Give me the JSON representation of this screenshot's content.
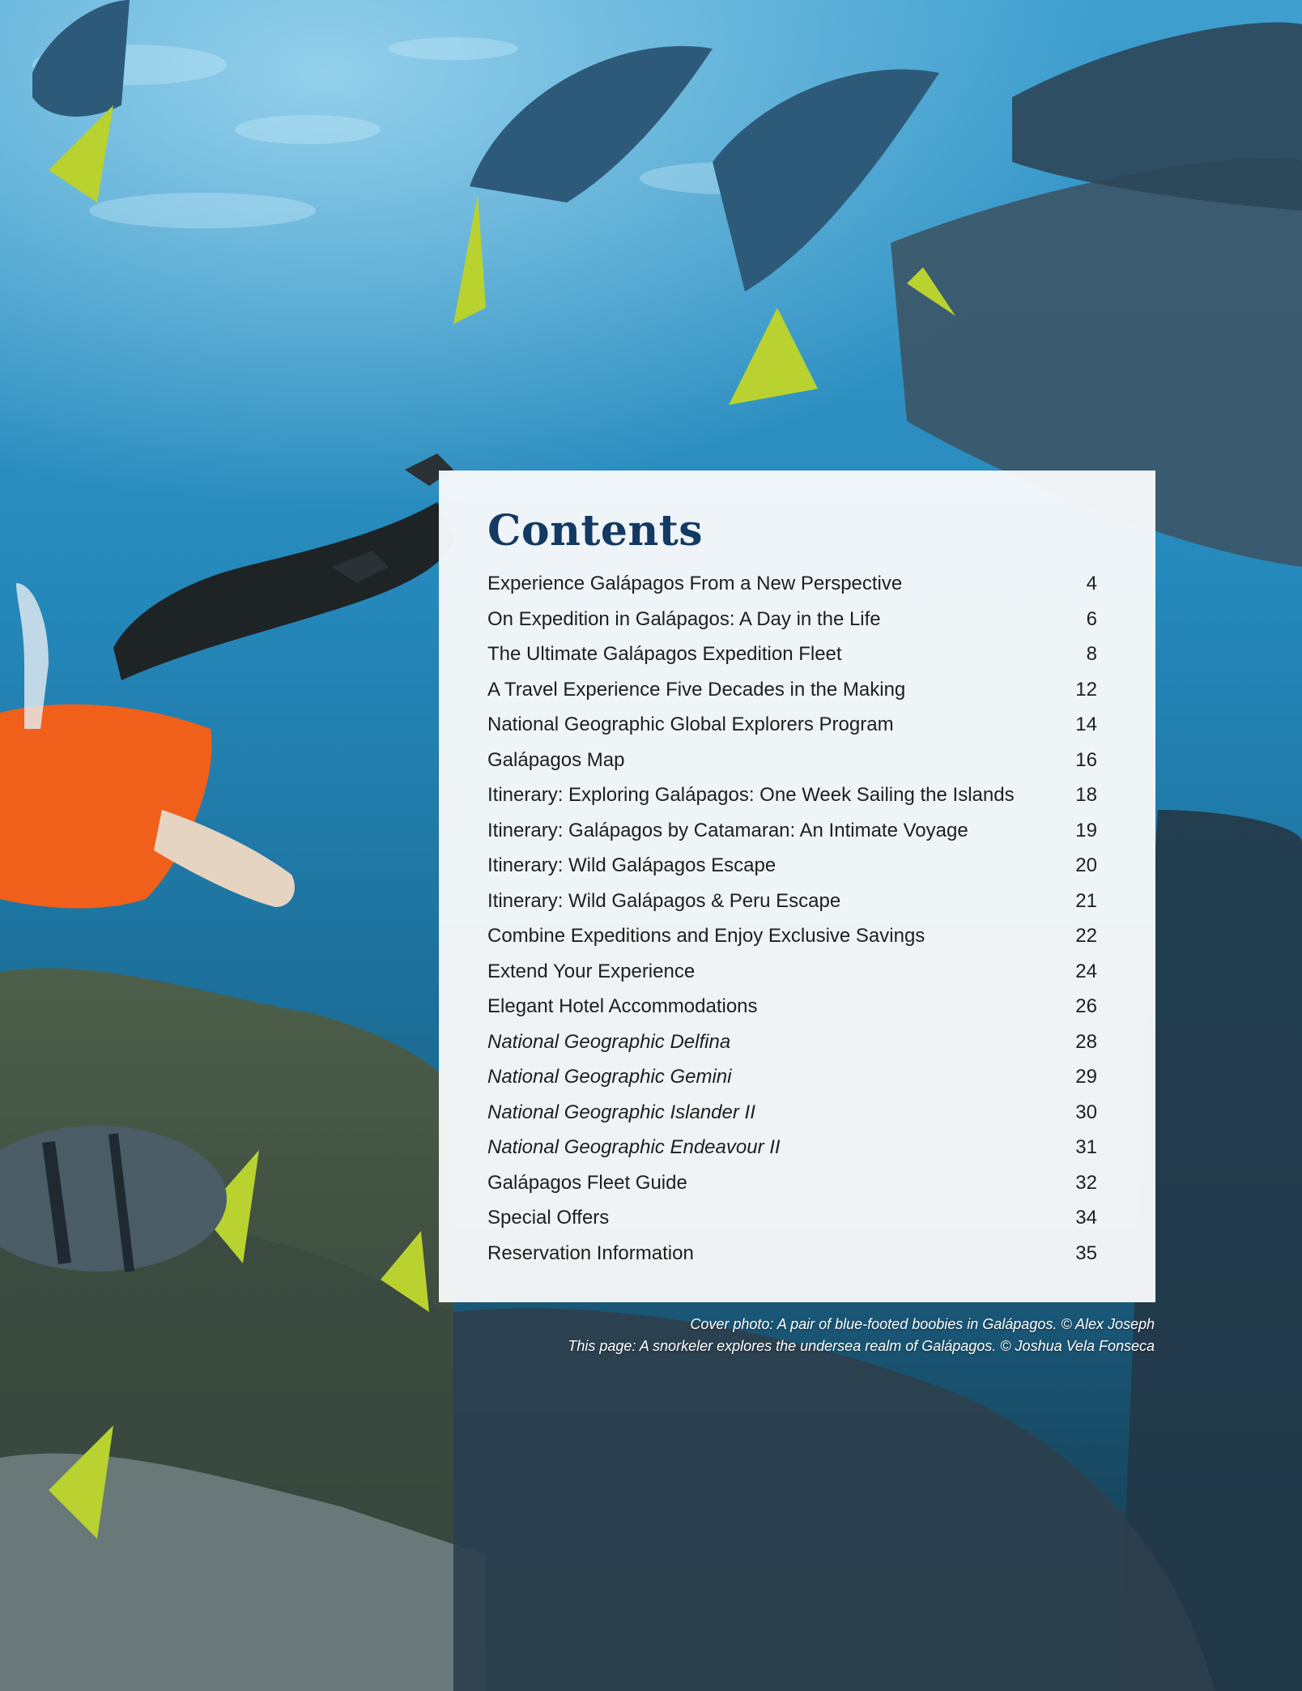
{
  "contents": {
    "title": "Contents",
    "entries": [
      {
        "label": "Experience Galápagos From a New Perspective",
        "page": "4",
        "italic": false
      },
      {
        "label": "On Expedition in Galápagos: A Day in the Life",
        "page": "6",
        "italic": false
      },
      {
        "label": "The Ultimate Galápagos Expedition Fleet",
        "page": "8",
        "italic": false
      },
      {
        "label": "A Travel Experience Five Decades in the Making",
        "page": "12",
        "italic": false
      },
      {
        "label": "National Geographic Global Explorers Program",
        "page": "14",
        "italic": false
      },
      {
        "label": "Galápagos Map",
        "page": "16",
        "italic": false
      },
      {
        "label": "Itinerary: Exploring Galápagos: One Week Sailing the Islands",
        "page": "18",
        "italic": false
      },
      {
        "label": "Itinerary: Galápagos by Catamaran: An Intimate Voyage",
        "page": "19",
        "italic": false
      },
      {
        "label": "Itinerary: Wild Galápagos Escape",
        "page": "20",
        "italic": false
      },
      {
        "label": "Itinerary: Wild Galápagos & Peru Escape",
        "page": "21",
        "italic": false
      },
      {
        "label": "Combine Expeditions and Enjoy Exclusive Savings",
        "page": "22",
        "italic": false
      },
      {
        "label": "Extend Your Experience",
        "page": "24",
        "italic": false
      },
      {
        "label": "Elegant Hotel Accommodations",
        "page": "26",
        "italic": false
      },
      {
        "label": "National Geographic Delfina",
        "page": "28",
        "italic": true
      },
      {
        "label": "National Geographic Gemini",
        "page": "29",
        "italic": true
      },
      {
        "label": "National Geographic Islander II",
        "page": "30",
        "italic": true
      },
      {
        "label": "National Geographic Endeavour II",
        "page": "31",
        "italic": true
      },
      {
        "label": "Galápagos Fleet Guide",
        "page": "32",
        "italic": false
      },
      {
        "label": "Special Offers",
        "page": "34",
        "italic": false
      },
      {
        "label": "Reservation Information",
        "page": "35",
        "italic": false
      }
    ]
  },
  "captions": {
    "cover": "Cover photo: A pair of blue-footed boobies in Galápagos. © Alex Joseph",
    "this_page": "This page: A snorkeler explores the undersea realm of Galápagos. © Joshua Vela Fonseca"
  },
  "colors": {
    "title": "#123a62",
    "panel": "#f8f9fa",
    "water": "#2a8fc0",
    "shirt": "#f0601a"
  }
}
